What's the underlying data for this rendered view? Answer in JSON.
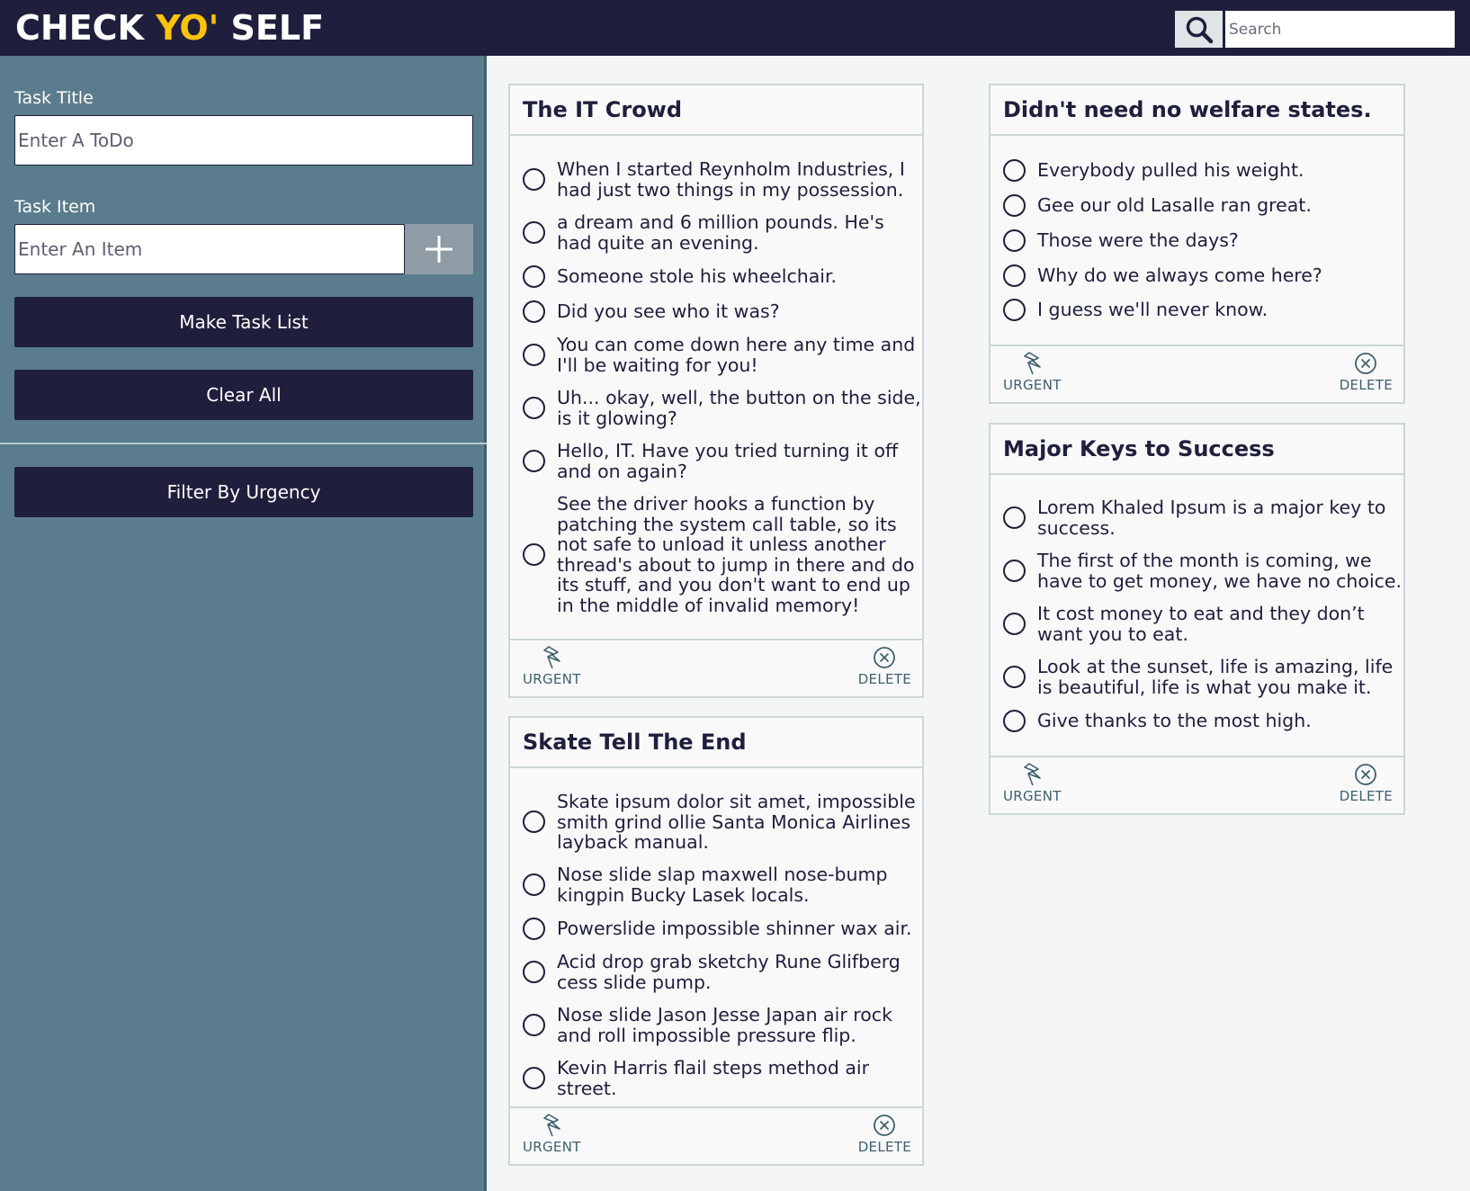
{
  "header": {
    "logo_part1": "CHECK ",
    "logo_accent": "YO'",
    "logo_part3": " SELF",
    "search_placeholder": "Search",
    "accent_color": "#ffc30b",
    "bg_color": "#1f1f3d"
  },
  "sidebar": {
    "task_title_label": "Task Title",
    "task_title_placeholder": "Enter A ToDo",
    "task_item_label": "Task Item",
    "task_item_placeholder": "Enter An Item",
    "add_icon": "plus-icon",
    "make_list_label": "Make Task List",
    "clear_all_label": "Clear All",
    "filter_label": "Filter By Urgency",
    "bg_color": "#5b7c8c"
  },
  "cards": [
    {
      "title": "The IT Crowd",
      "items": [
        "When I started Reynholm Industries, I had just two things in my possession.",
        "a dream and 6 million pounds. He's had quite an evening.",
        "Someone stole his wheelchair.",
        "Did you see who it was?",
        "You can come down here any time and I'll be waiting for you!",
        "Uh... okay, well, the button on the side, is it glowing?",
        "Hello, IT. Have you tried turning it off and on again?",
        "See the driver hooks a function by patching the system call table, so its not safe to unload it unless another thread's about to jump in there and do its stuff, and you don't want to end up in the middle of invalid memory!"
      ],
      "urgent_label": "URGENT",
      "delete_label": "DELETE"
    },
    {
      "title": "Skate Tell The End",
      "items": [
        "Skate ipsum dolor sit amet, impossible smith grind ollie Santa Monica Airlines layback manual.",
        "Nose slide slap maxwell nose-bump kingpin Bucky Lasek locals.",
        "Powerslide impossible shinner wax air.",
        "Acid drop grab sketchy Rune Glifberg cess slide pump.",
        "Nose slide Jason Jesse Japan air rock and roll impossible pressure flip.",
        "Kevin Harris flail steps method air street."
      ],
      "urgent_label": "URGENT",
      "delete_label": "DELETE"
    },
    {
      "title": "Didn't need no welfare states.",
      "items": [
        "Everybody pulled his weight.",
        "Gee our old Lasalle ran great.",
        "Those were the days?",
        "Why do we always come here?",
        "I guess we'll never know."
      ],
      "urgent_label": "URGENT",
      "delete_label": "DELETE"
    },
    {
      "title": "Major Keys to Success",
      "items": [
        "Lorem Khaled Ipsum is a major key to success.",
        "The first of the month is coming, we have to get money, we have no choice.",
        "It cost money to eat and they don’t want you to eat.",
        "Look at the sunset, life is amazing, life is beautiful, life is what you make it.",
        "Give thanks to the most high."
      ],
      "urgent_label": "URGENT",
      "delete_label": "DELETE"
    }
  ]
}
